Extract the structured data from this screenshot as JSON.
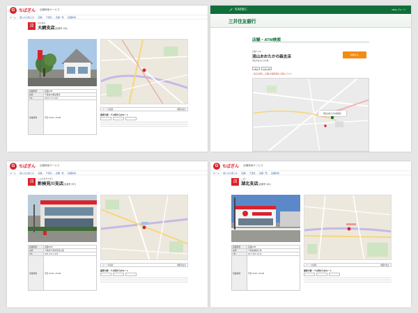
{
  "common": {
    "logo_mark": "G",
    "logo_text": "ちばぎん",
    "site_sub": "店舗検索サービス",
    "breadcrumb": [
      "ホーム",
      "個人のお客さま",
      "店舗",
      "千葉県",
      "店舗一覧",
      "店舗情報"
    ],
    "badge_line1": "店舗",
    "badge_line2": "ATM",
    "table_labels": [
      "店舗形態",
      "住所",
      "TEL",
      "営業時間"
    ],
    "route_bar_label": "ルートを検索",
    "route_bar_right": "地図を拡大",
    "route_heading": "最寄り駅・バス停からのルート",
    "photo_sign": "ちばぎん"
  },
  "panels": {
    "p1": {
      "kana": "おおあみ",
      "title": "大網支店",
      "title_code": "(店番号 136)",
      "table_values": [
        "店舗ATM",
        "千葉県大網白里市",
        "0475-72-1161",
        "平日 9:00~15:00"
      ]
    },
    "p2": {
      "header_logo": "SMBC",
      "header_right": "SMBC グループ",
      "bank_name": "三井住友銀行",
      "page_heading": "店舗・ATM検索",
      "branch_code": "店番号 307",
      "branch_name": "流山おおたかの森支店",
      "address": "流山市おおたかの森",
      "button_label": "印刷する",
      "tags": [
        "平日",
        "土日・祝"
      ],
      "notice": "ご来店の際は、店舗の営業時間をご確認ください",
      "map_callout": "流山おおたかの森支店"
    },
    "p3": {
      "kana": "しんかまがやまえ",
      "title": "新検見川支店",
      "title_code": "(店番号 097)",
      "table_values": [
        "店舗ATM",
        "千葉県千葉市花見川区",
        "043-271-1121",
        "平日 9:00~15:00"
      ]
    },
    "p4": {
      "kana": "こほく",
      "title": "湖北支店",
      "title_code": "(店番号 181)",
      "table_values": [
        "店舗ATM",
        "千葉県我孫子市",
        "04-7187-2111",
        "平日 9:00~15:00"
      ]
    }
  }
}
